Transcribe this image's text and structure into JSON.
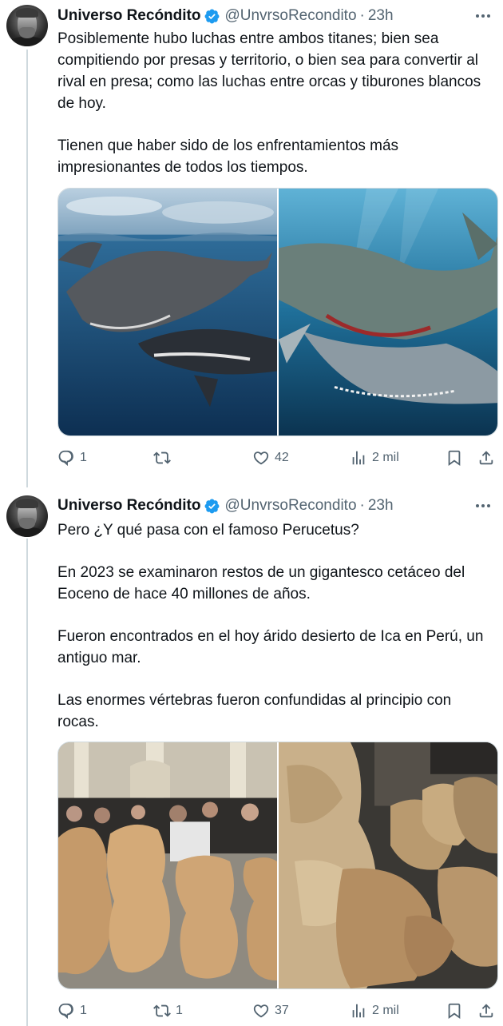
{
  "tweets": [
    {
      "author": {
        "name": "Universo Recóndito",
        "handle": "@UnvrsoRecondito",
        "time": "23h"
      },
      "paragraphs": [
        "Posiblemente hubo luchas entre ambos titanes; bien sea compitiendo por presas y territorio, o bien sea para convertir al rival en presa; como las luchas entre orcas y tiburones blancos de hoy.",
        "Tienen que haber sido de los enfrentamientos más impresionantes de todos los tiempos."
      ],
      "stats": {
        "replies": "1",
        "retweets": "",
        "likes": "42",
        "views": "2 mil"
      }
    },
    {
      "author": {
        "name": "Universo Recóndito",
        "handle": "@UnvrsoRecondito",
        "time": "23h"
      },
      "paragraphs": [
        "Pero ¿Y qué pasa con el famoso Perucetus?",
        "En 2023 se examinaron restos de un gigantesco cetáceo del Eoceno de hace 40 millones de años.",
        "Fueron encontrados en el hoy árido desierto de Ica en Perú, un antiguo mar.",
        "Las enormes vértebras fueron confundidas al principio con rocas."
      ],
      "stats": {
        "replies": "1",
        "retweets": "1",
        "likes": "37",
        "views": "2 mil"
      }
    }
  ],
  "colors": {
    "text": "#0f1419",
    "secondary": "#536471",
    "verified": "#1d9bf0",
    "border": "#cfd9de"
  },
  "icons": [
    "verified-badge-icon",
    "more-icon",
    "reply-icon",
    "retweet-icon",
    "like-icon",
    "views-icon",
    "bookmark-icon",
    "share-icon"
  ]
}
